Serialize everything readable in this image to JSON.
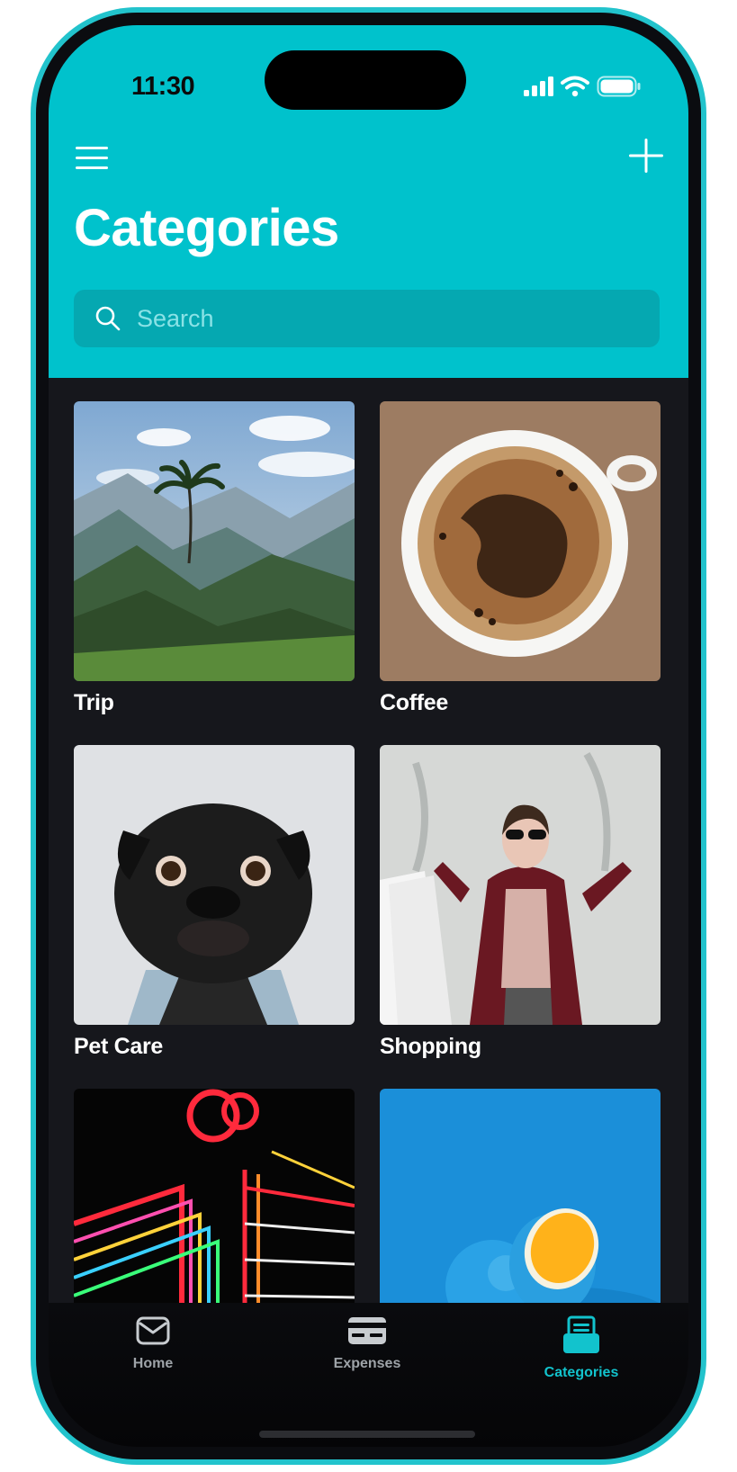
{
  "status_bar": {
    "time": "11:30"
  },
  "header": {
    "title": "Categories",
    "menu_icon": "hamburger-menu-icon",
    "add_icon": "plus-icon"
  },
  "search": {
    "placeholder": "Search",
    "value": ""
  },
  "categories": [
    {
      "label": "Trip",
      "image": "mountain-palm-landscape"
    },
    {
      "label": "Coffee",
      "image": "coffee-cup-top-view"
    },
    {
      "label": "Pet Care",
      "image": "black-pug-in-denim"
    },
    {
      "label": "Shopping",
      "image": "woman-with-shopping-bags"
    },
    {
      "label": "",
      "image": "neon-sign"
    },
    {
      "label": "",
      "image": "oranges-on-blue"
    }
  ],
  "tabbar": {
    "items": [
      {
        "label": "Home",
        "icon": "envelope-icon",
        "active": false
      },
      {
        "label": "Expenses",
        "icon": "credit-card-icon",
        "active": false
      },
      {
        "label": "Categories",
        "icon": "stacked-documents-icon",
        "active": true
      }
    ]
  },
  "colors": {
    "accent": "#00c2cc",
    "search_bg": "#05a8b1",
    "background": "#16171c",
    "active_tab": "#12c3cd",
    "inactive_tab": "#9ea3a8",
    "frame": "#22c3cc"
  }
}
